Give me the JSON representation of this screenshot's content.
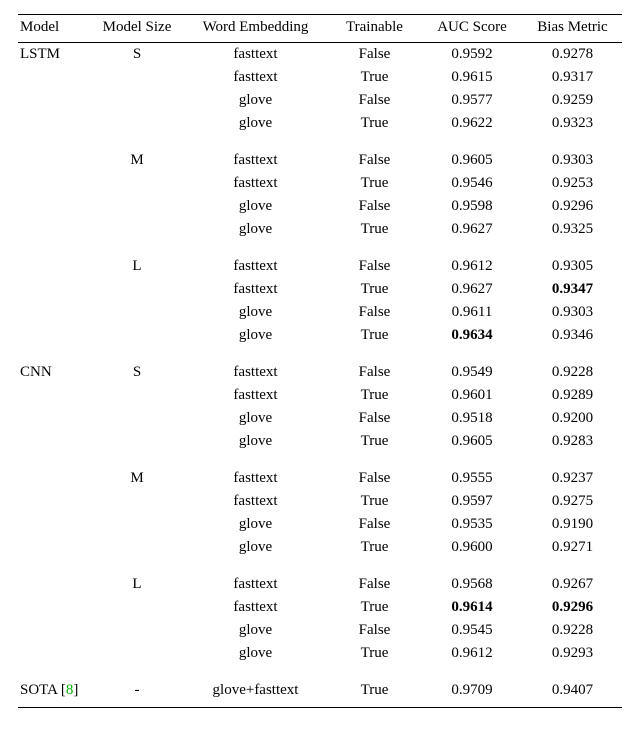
{
  "headers": {
    "model": "Model",
    "size": "Model Size",
    "emb": "Word Embedding",
    "trainable": "Trainable",
    "auc": "AUC Score",
    "bias": "Bias Metric"
  },
  "blocks": [
    {
      "model": "LSTM",
      "sizes": [
        {
          "size": "S",
          "rows": [
            {
              "emb": "fasttext",
              "trainable": "False",
              "auc": "0.9592",
              "bias": "0.9278"
            },
            {
              "emb": "fasttext",
              "trainable": "True",
              "auc": "0.9615",
              "bias": "0.9317"
            },
            {
              "emb": "glove",
              "trainable": "False",
              "auc": "0.9577",
              "bias": "0.9259"
            },
            {
              "emb": "glove",
              "trainable": "True",
              "auc": "0.9622",
              "bias": "0.9323"
            }
          ]
        },
        {
          "size": "M",
          "rows": [
            {
              "emb": "fasttext",
              "trainable": "False",
              "auc": "0.9605",
              "bias": "0.9303"
            },
            {
              "emb": "fasttext",
              "trainable": "True",
              "auc": "0.9546",
              "bias": "0.9253"
            },
            {
              "emb": "glove",
              "trainable": "False",
              "auc": "0.9598",
              "bias": "0.9296"
            },
            {
              "emb": "glove",
              "trainable": "True",
              "auc": "0.9627",
              "bias": "0.9325"
            }
          ]
        },
        {
          "size": "L",
          "rows": [
            {
              "emb": "fasttext",
              "trainable": "False",
              "auc": "0.9612",
              "bias": "0.9305"
            },
            {
              "emb": "fasttext",
              "trainable": "True",
              "auc": "0.9627",
              "bias": "0.9347",
              "bias_bold": true
            },
            {
              "emb": "glove",
              "trainable": "False",
              "auc": "0.9611",
              "bias": "0.9303"
            },
            {
              "emb": "glove",
              "trainable": "True",
              "auc": "0.9634",
              "auc_bold": true,
              "bias": "0.9346"
            }
          ]
        }
      ]
    },
    {
      "model": "CNN",
      "sizes": [
        {
          "size": "S",
          "rows": [
            {
              "emb": "fasttext",
              "trainable": "False",
              "auc": "0.9549",
              "bias": "0.9228"
            },
            {
              "emb": "fasttext",
              "trainable": "True",
              "auc": "0.9601",
              "bias": "0.9289"
            },
            {
              "emb": "glove",
              "trainable": "False",
              "auc": "0.9518",
              "bias": "0.9200"
            },
            {
              "emb": "glove",
              "trainable": "True",
              "auc": "0.9605",
              "bias": "0.9283"
            }
          ]
        },
        {
          "size": "M",
          "rows": [
            {
              "emb": "fasttext",
              "trainable": "False",
              "auc": "0.9555",
              "bias": "0.9237"
            },
            {
              "emb": "fasttext",
              "trainable": "True",
              "auc": "0.9597",
              "bias": "0.9275"
            },
            {
              "emb": "glove",
              "trainable": "False",
              "auc": "0.9535",
              "bias": "0.9190"
            },
            {
              "emb": "glove",
              "trainable": "True",
              "auc": "0.9600",
              "bias": "0.9271"
            }
          ]
        },
        {
          "size": "L",
          "rows": [
            {
              "emb": "fasttext",
              "trainable": "False",
              "auc": "0.9568",
              "bias": "0.9267"
            },
            {
              "emb": "fasttext",
              "trainable": "True",
              "auc": "0.9614",
              "auc_bold": true,
              "bias": "0.9296",
              "bias_bold": true
            },
            {
              "emb": "glove",
              "trainable": "False",
              "auc": "0.9545",
              "bias": "0.9228"
            },
            {
              "emb": "glove",
              "trainable": "True",
              "auc": "0.9612",
              "bias": "0.9293"
            }
          ]
        }
      ]
    }
  ],
  "sota": {
    "model": "SOTA",
    "cite_open": " [",
    "cite": "8",
    "cite_close": "]",
    "size": "-",
    "emb": "glove+fasttext",
    "trainable": "True",
    "auc": "0.9709",
    "bias": "0.9407"
  },
  "chart_data": {
    "type": "table",
    "title": "Model comparison: AUC Score and Bias Metric by architecture, size, embedding, and trainability",
    "columns": [
      "Model",
      "Model Size",
      "Word Embedding",
      "Trainable",
      "AUC Score",
      "Bias Metric"
    ],
    "rows": [
      [
        "LSTM",
        "S",
        "fasttext",
        "False",
        0.9592,
        0.9278
      ],
      [
        "LSTM",
        "S",
        "fasttext",
        "True",
        0.9615,
        0.9317
      ],
      [
        "LSTM",
        "S",
        "glove",
        "False",
        0.9577,
        0.9259
      ],
      [
        "LSTM",
        "S",
        "glove",
        "True",
        0.9622,
        0.9323
      ],
      [
        "LSTM",
        "M",
        "fasttext",
        "False",
        0.9605,
        0.9303
      ],
      [
        "LSTM",
        "M",
        "fasttext",
        "True",
        0.9546,
        0.9253
      ],
      [
        "LSTM",
        "M",
        "glove",
        "False",
        0.9598,
        0.9296
      ],
      [
        "LSTM",
        "M",
        "glove",
        "True",
        0.9627,
        0.9325
      ],
      [
        "LSTM",
        "L",
        "fasttext",
        "False",
        0.9612,
        0.9305
      ],
      [
        "LSTM",
        "L",
        "fasttext",
        "True",
        0.9627,
        0.9347
      ],
      [
        "LSTM",
        "L",
        "glove",
        "False",
        0.9611,
        0.9303
      ],
      [
        "LSTM",
        "L",
        "glove",
        "True",
        0.9634,
        0.9346
      ],
      [
        "CNN",
        "S",
        "fasttext",
        "False",
        0.9549,
        0.9228
      ],
      [
        "CNN",
        "S",
        "fasttext",
        "True",
        0.9601,
        0.9289
      ],
      [
        "CNN",
        "S",
        "glove",
        "False",
        0.9518,
        0.92
      ],
      [
        "CNN",
        "S",
        "glove",
        "True",
        0.9605,
        0.9283
      ],
      [
        "CNN",
        "M",
        "fasttext",
        "False",
        0.9555,
        0.9237
      ],
      [
        "CNN",
        "M",
        "fasttext",
        "True",
        0.9597,
        0.9275
      ],
      [
        "CNN",
        "M",
        "glove",
        "False",
        0.9535,
        0.919
      ],
      [
        "CNN",
        "M",
        "glove",
        "True",
        0.96,
        0.9271
      ],
      [
        "CNN",
        "L",
        "fasttext",
        "False",
        0.9568,
        0.9267
      ],
      [
        "CNN",
        "L",
        "fasttext",
        "True",
        0.9614,
        0.9296
      ],
      [
        "CNN",
        "L",
        "glove",
        "False",
        0.9545,
        0.9228
      ],
      [
        "CNN",
        "L",
        "glove",
        "True",
        0.9612,
        0.9293
      ],
      [
        "SOTA [8]",
        "-",
        "glove+fasttext",
        "True",
        0.9709,
        0.9407
      ]
    ],
    "bold_cells": [
      {
        "row_index": 9,
        "column": "Bias Metric"
      },
      {
        "row_index": 11,
        "column": "AUC Score"
      },
      {
        "row_index": 19,
        "column": "AUC Score"
      },
      {
        "row_index": 19,
        "column": "Bias Metric"
      }
    ]
  }
}
